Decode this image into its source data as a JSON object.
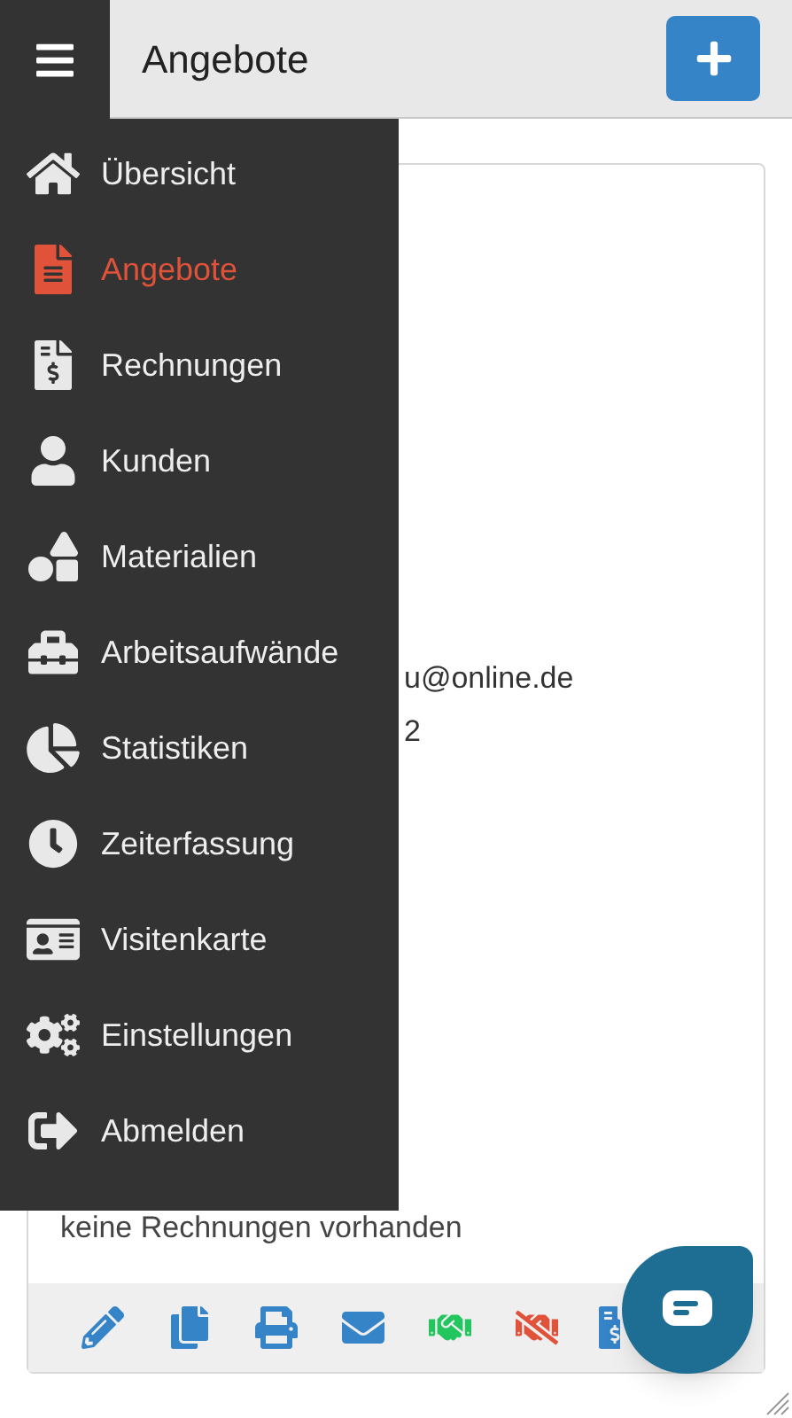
{
  "header": {
    "title": "Angebote"
  },
  "sidebar": {
    "items": [
      {
        "label": "Übersicht",
        "selected": false
      },
      {
        "label": "Angebote",
        "selected": true
      },
      {
        "label": "Rechnungen",
        "selected": false
      },
      {
        "label": "Kunden",
        "selected": false
      },
      {
        "label": "Materialien",
        "selected": false
      },
      {
        "label": "Arbeitsaufwände",
        "selected": false
      },
      {
        "label": "Statistiken",
        "selected": false
      },
      {
        "label": "Zeiterfassung",
        "selected": false
      },
      {
        "label": "Visitenkarte",
        "selected": false
      },
      {
        "label": "Einstellungen",
        "selected": false
      },
      {
        "label": "Abmelden",
        "selected": false
      }
    ]
  },
  "card": {
    "lines": [
      "u@online.de",
      "2"
    ],
    "empty_text": "keine Rechnungen vorhanden"
  }
}
